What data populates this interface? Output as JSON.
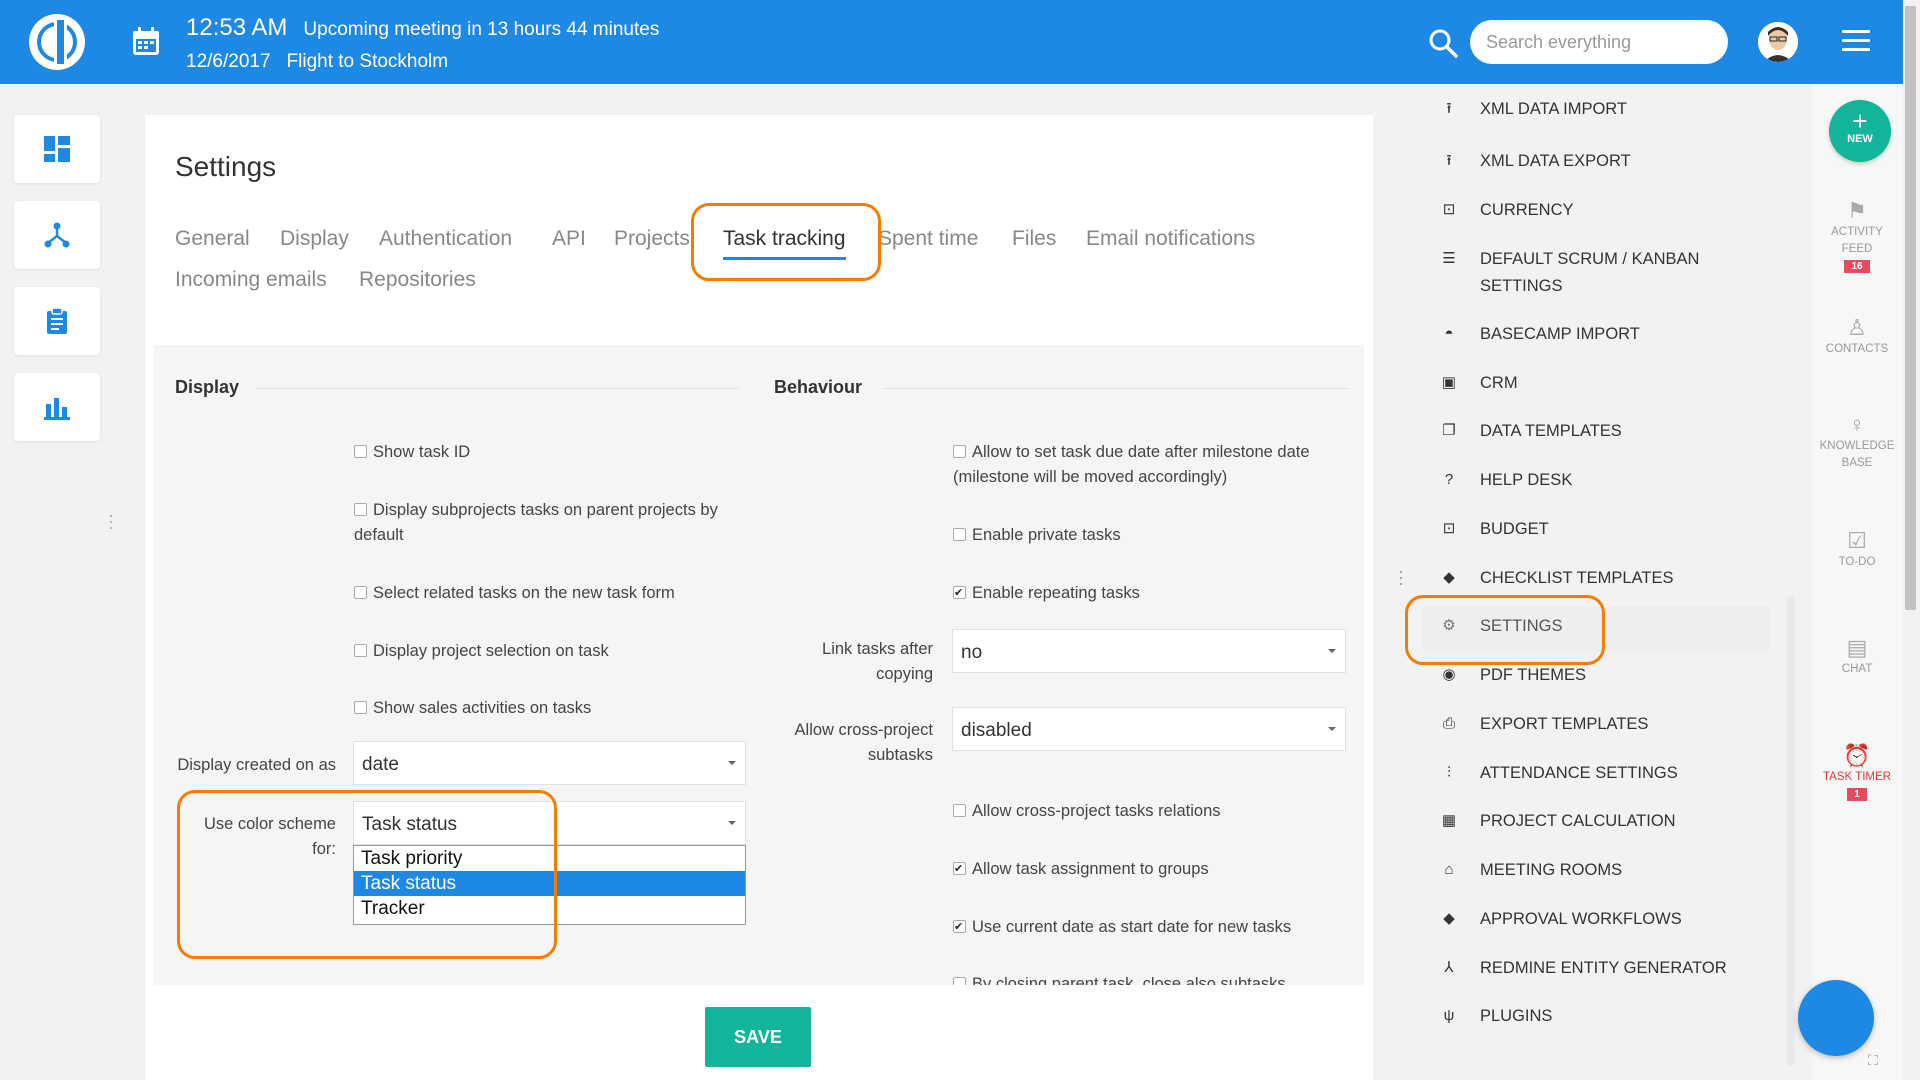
{
  "header": {
    "time": "12:53 AM",
    "meeting": "Upcoming meeting in 13 hours 44 minutes",
    "date": "12/6/2017",
    "event": "Flight to Stockholm",
    "search_placeholder": "Search everything"
  },
  "page": {
    "title": "Settings",
    "tabs": [
      {
        "label": "General"
      },
      {
        "label": "Display"
      },
      {
        "label": "Authentication"
      },
      {
        "label": "API"
      },
      {
        "label": "Projects"
      },
      {
        "label": "Task tracking",
        "active": true
      },
      {
        "label": "Spent time"
      },
      {
        "label": "Files"
      },
      {
        "label": "Email notifications"
      },
      {
        "label": "Incoming emails"
      },
      {
        "label": "Repositories"
      }
    ]
  },
  "display": {
    "heading": "Display",
    "checkboxes": [
      {
        "line1": "Show task ID",
        "line2": "",
        "checked": false
      },
      {
        "line1": "Display subprojects tasks on parent projects by",
        "line2": "default",
        "checked": false
      },
      {
        "line1": "Select related tasks on the new task form",
        "line2": "",
        "checked": false
      },
      {
        "line1": "Display project selection on task",
        "line2": "",
        "checked": false
      },
      {
        "line1": "Show sales activities on tasks",
        "line2": "",
        "checked": false
      }
    ],
    "created_on_label": "Display created on as",
    "created_on_value": "date",
    "color_scheme_label1": "Use color scheme",
    "color_scheme_label2": "for:",
    "color_scheme_value": "Task status",
    "color_scheme_options": [
      {
        "label": "Task priority",
        "selected": false
      },
      {
        "label": "Task status",
        "selected": true
      },
      {
        "label": "Tracker",
        "selected": false
      }
    ]
  },
  "behaviour": {
    "heading": "Behaviour",
    "cb_due": {
      "line1": "Allow to set task due date after milestone date",
      "line2": "(milestone will be moved accordingly)",
      "checked": false
    },
    "cb_private": {
      "label": "Enable private tasks",
      "checked": false
    },
    "cb_repeating": {
      "label": "Enable repeating tasks",
      "checked": true
    },
    "link_label1": "Link tasks after",
    "link_label2": "copying",
    "link_value": "no",
    "cross_label1": "Allow cross-project",
    "cross_label2": "subtasks",
    "cross_value": "disabled",
    "cb_relations": {
      "label": "Allow cross-project tasks relations",
      "checked": false
    },
    "cb_groups": {
      "label": "Allow task assignment to groups",
      "checked": true
    },
    "cb_startdate": {
      "label": "Use current date as start date for new tasks",
      "checked": true
    },
    "cb_closing": {
      "label": "By closing parent task, close also subtasks",
      "checked": false
    }
  },
  "save_label": "SAVE",
  "admin_menu": [
    {
      "label": "XML DATA IMPORT",
      "icon": "upload-icon"
    },
    {
      "label": "XML DATA EXPORT",
      "icon": "upload-icon"
    },
    {
      "label": "CURRENCY",
      "icon": "currency-icon"
    },
    {
      "label": "DEFAULT SCRUM / KANBAN",
      "label2": "SETTINGS",
      "icon": "list-check-icon"
    },
    {
      "label": "BASECAMP IMPORT",
      "icon": "basecamp-icon"
    },
    {
      "label": "CRM",
      "icon": "briefcase-icon"
    },
    {
      "label": "DATA TEMPLATES",
      "icon": "copy-icon"
    },
    {
      "label": "HELP DESK",
      "icon": "help-icon"
    },
    {
      "label": "BUDGET",
      "icon": "currency-icon"
    },
    {
      "label": "CHECKLIST TEMPLATES",
      "icon": "diamond-icon"
    },
    {
      "label": "SETTINGS",
      "icon": "gear-icon"
    },
    {
      "label": "PDF THEMES",
      "icon": "eye-icon"
    },
    {
      "label": "EXPORT TEMPLATES",
      "icon": "print-icon"
    },
    {
      "label": "ATTENDANCE SETTINGS",
      "icon": "sliders-icon"
    },
    {
      "label": "PROJECT CALCULATION",
      "icon": "calculator-icon"
    },
    {
      "label": "MEETING ROOMS",
      "icon": "home-icon"
    },
    {
      "label": "APPROVAL WORKFLOWS",
      "icon": "diamond-icon"
    },
    {
      "label": "REDMINE ENTITY GENERATOR",
      "icon": "hierarchy-icon"
    },
    {
      "label": "PLUGINS",
      "icon": "plug-icon"
    }
  ],
  "right_rail": {
    "new_label": "NEW",
    "activity_label1": "ACTIVITY",
    "activity_label2": "FEED",
    "activity_badge": "16",
    "contacts_label": "CONTACTS",
    "knowledge_label1": "KNOWLEDGE",
    "knowledge_label2": "BASE",
    "todo_label": "TO-DO",
    "chat_label": "CHAT",
    "timer_label": "TASK TIMER",
    "timer_badge": "1"
  },
  "colors": {
    "brand": "#1e88e5",
    "save": "#12b59a",
    "highlight": "#f57c00",
    "badge": "#e84a5f"
  }
}
